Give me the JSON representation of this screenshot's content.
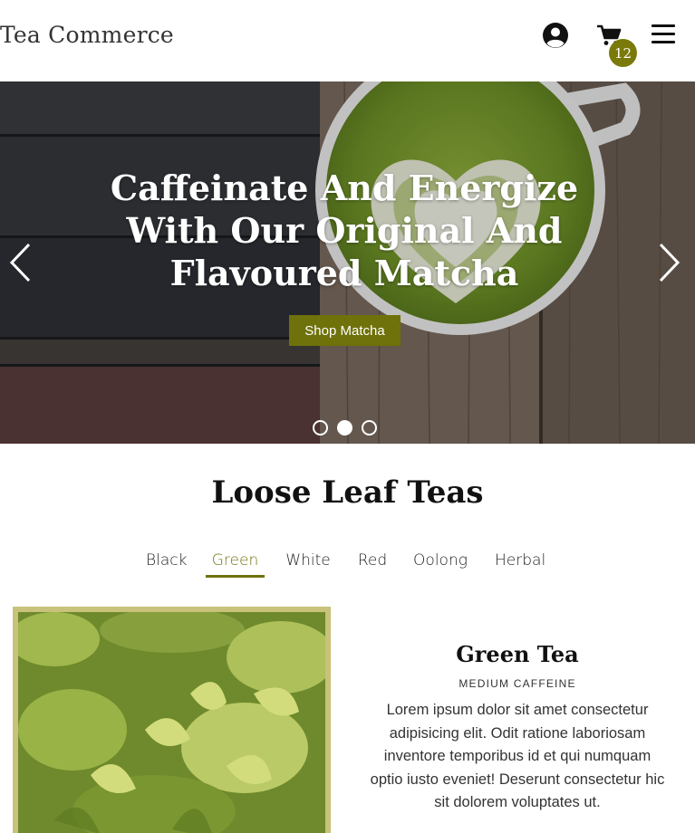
{
  "header": {
    "brand": "Tea Commerce",
    "cart_count": "12",
    "icons": {
      "account": "user-circle-icon",
      "cart": "shopping-cart-icon",
      "menu": "hamburger-menu-icon"
    }
  },
  "hero": {
    "title": "Caffeinate And Energize With Our Original And Flavoured Matcha",
    "button_label": "Shop Matcha",
    "slides_total": 3,
    "active_slide": 2,
    "icons": {
      "prev": "chevron-left-icon",
      "next": "chevron-right-icon"
    }
  },
  "section": {
    "title": "Loose Leaf Teas",
    "tabs": [
      {
        "label": "Black",
        "active": false
      },
      {
        "label": "Green",
        "active": true
      },
      {
        "label": "White",
        "active": false
      },
      {
        "label": "Red",
        "active": false
      },
      {
        "label": "Oolong",
        "active": false
      },
      {
        "label": "Herbal",
        "active": false
      }
    ]
  },
  "product": {
    "name": "Green Tea",
    "caffeine": "MEDIUM CAFFEINE",
    "description": "Lorem ipsum dolor sit amet consectetur adipisicing elit. Odit ratione laboriosam inventore temporibus id et qui numquam optio iusto eveniet! Deserunt consectetur hic sit dolorem voluptates ut."
  },
  "colors": {
    "accent": "#6f720a",
    "badge": "#7a7a0a",
    "image_border": "#c8c27a"
  }
}
